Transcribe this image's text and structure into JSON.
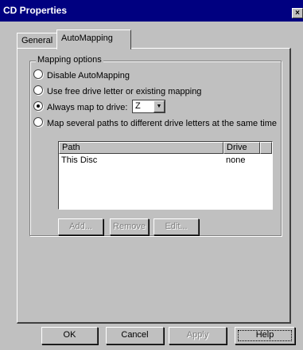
{
  "window": {
    "title": "CD Properties",
    "close_glyph": "×"
  },
  "tabs": [
    {
      "label": "General",
      "selected": false
    },
    {
      "label": "AutoMapping",
      "selected": true
    }
  ],
  "group": {
    "label": "Mapping options",
    "options": [
      {
        "label": "Disable AutoMapping",
        "checked": false
      },
      {
        "label": "Use free drive letter or existing mapping",
        "checked": false
      },
      {
        "label": "Always map to drive:",
        "checked": true
      },
      {
        "label": "Map several paths to different drive letters at the same time",
        "checked": false
      }
    ],
    "drive_select": {
      "value": "Z",
      "arrow": "▼"
    }
  },
  "list": {
    "columns": [
      "Path",
      "Drive"
    ],
    "rows": [
      {
        "path": "This Disc",
        "drive": "none"
      }
    ]
  },
  "list_buttons": {
    "add": "Add...",
    "remove": "Remove",
    "edit": "Edit..."
  },
  "dialog_buttons": {
    "ok": "OK",
    "cancel": "Cancel",
    "apply": "Apply",
    "help": "Help"
  }
}
